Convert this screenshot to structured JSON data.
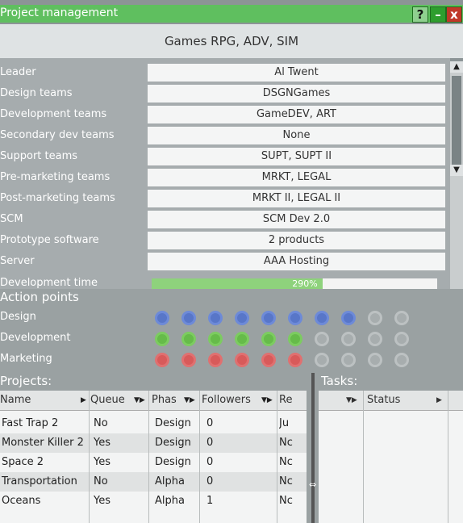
{
  "window": {
    "title": "Project management",
    "help_icon": "?",
    "minimize_icon": "–",
    "close_icon": "x"
  },
  "project": {
    "subtitle": "Games RPG, ADV, SIM"
  },
  "info_rows": [
    {
      "label": "Leader",
      "value": "Al Twent"
    },
    {
      "label": "Design teams",
      "value": "DSGNGames"
    },
    {
      "label": "Development teams",
      "value": "GameDEV, ART"
    },
    {
      "label": "Secondary dev teams",
      "value": "None"
    },
    {
      "label": "Support teams",
      "value": "SUPT, SUPT II"
    },
    {
      "label": "Pre-marketing teams",
      "value": "MRKT, LEGAL"
    },
    {
      "label": "Post-marketing teams",
      "value": "MRKT II, LEGAL II"
    },
    {
      "label": "SCM",
      "value": "SCM Dev 2.0"
    },
    {
      "label": "Prototype software",
      "value": "2 products"
    },
    {
      "label": "Server",
      "value": "AAA Hosting"
    }
  ],
  "development_time": {
    "label": "Development time",
    "text": "290%",
    "fill_fraction": 0.6
  },
  "action_points": {
    "title": "Action points",
    "rows": [
      {
        "label": "Design",
        "filled": 8,
        "total": 10,
        "color": "blue"
      },
      {
        "label": "Development",
        "filled": 6,
        "total": 10,
        "color": "green"
      },
      {
        "label": "Marketing",
        "filled": 6,
        "total": 10,
        "color": "red"
      }
    ]
  },
  "projects": {
    "title": "Projects:",
    "columns": [
      "Name",
      "Queue",
      "Phas",
      "Followers",
      "Re"
    ],
    "rows": [
      [
        "Fast Trap 2",
        "No",
        "Design",
        "0",
        "Ju"
      ],
      [
        "Monster Killer 2",
        "Yes",
        "Design",
        "0",
        "Nc"
      ],
      [
        "Space 2",
        "Yes",
        "Design",
        "0",
        "Nc"
      ],
      [
        "Transportation",
        "No",
        "Alpha",
        "0",
        "Nc"
      ],
      [
        "Oceans",
        "Yes",
        "Alpha",
        "1",
        "Nc"
      ]
    ]
  },
  "tasks": {
    "title": "Tasks:",
    "columns": [
      "Status"
    ]
  }
}
